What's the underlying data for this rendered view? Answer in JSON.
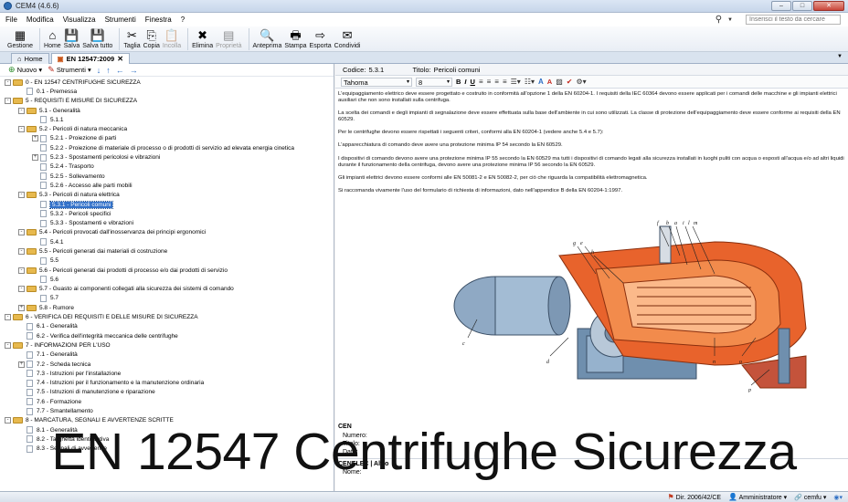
{
  "window": {
    "title": "CEM4 (4.6.6)"
  },
  "menu": [
    "File",
    "Modifica",
    "Visualizza",
    "Strumenti",
    "Finestra",
    "?"
  ],
  "search": {
    "placeholder": "Inserisci il testo da cercare"
  },
  "ribbon": [
    {
      "label": "Gestione",
      "icon": "grid-icon",
      "glyph": "▦",
      "disabled": false
    },
    {
      "label": "Home",
      "icon": "home-icon",
      "glyph": "⌂",
      "disabled": false
    },
    {
      "label": "Salva",
      "icon": "save-icon",
      "glyph": "💾",
      "disabled": false
    },
    {
      "label": "Salva tutto",
      "icon": "save-all-icon",
      "glyph": "💾",
      "disabled": false
    },
    {
      "label": "Taglia",
      "icon": "cut-icon",
      "glyph": "✂",
      "disabled": false
    },
    {
      "label": "Copia",
      "icon": "copy-icon",
      "glyph": "⎘",
      "disabled": false
    },
    {
      "label": "Incolla",
      "icon": "paste-icon",
      "glyph": "📋",
      "disabled": true
    },
    {
      "label": "Elimina",
      "icon": "delete-icon",
      "glyph": "✖",
      "disabled": false
    },
    {
      "label": "Proprietà",
      "icon": "properties-icon",
      "glyph": "▤",
      "disabled": true
    },
    {
      "label": "Anteprima",
      "icon": "preview-icon",
      "glyph": "🔍",
      "disabled": false
    },
    {
      "label": "Stampa",
      "icon": "print-icon",
      "glyph": "🖶",
      "disabled": false
    },
    {
      "label": "Esporta",
      "icon": "export-icon",
      "glyph": "⇨",
      "disabled": false
    },
    {
      "label": "Condividi",
      "icon": "share-icon",
      "glyph": "✉",
      "disabled": false
    }
  ],
  "tabs": [
    {
      "label": "Home",
      "active": false
    },
    {
      "label": "EN 12547:2009",
      "active": true
    }
  ],
  "tree_toolbar": {
    "new_label": "Nuovo",
    "tools_label": "Strumenti"
  },
  "tree": [
    {
      "level": 0,
      "type": "folder",
      "exp": "-",
      "label": "0 - EN 12547 CENTRIFUGHE SICUREZZA"
    },
    {
      "level": 1,
      "type": "doc",
      "exp": "",
      "label": "0.1 - Premessa"
    },
    {
      "level": 0,
      "type": "folder",
      "exp": "-",
      "label": "5 - REQUISITI E MISURE DI SICUREZZA"
    },
    {
      "level": 1,
      "type": "folder",
      "exp": "-",
      "label": "5.1 - Generalità"
    },
    {
      "level": 2,
      "type": "doc",
      "exp": "",
      "label": "5.1.1"
    },
    {
      "level": 1,
      "type": "folder",
      "exp": "-",
      "label": "5.2 - Pericoli di natura meccanica"
    },
    {
      "level": 2,
      "type": "doc",
      "exp": "+",
      "label": "5.2.1 - Proiezione di parti"
    },
    {
      "level": 2,
      "type": "doc",
      "exp": "",
      "label": "5.2.2 - Proiezione di materiale di processo o di prodotti di servizio ad elevata energia cinetica"
    },
    {
      "level": 2,
      "type": "doc",
      "exp": "+",
      "label": "5.2.3 - Spostamenti pericolosi e vibrazioni"
    },
    {
      "level": 2,
      "type": "doc",
      "exp": "",
      "label": "5.2.4 - Trasporto"
    },
    {
      "level": 2,
      "type": "doc",
      "exp": "",
      "label": "5.2.5 - Sollevamento"
    },
    {
      "level": 2,
      "type": "doc",
      "exp": "",
      "label": "5.2.6 - Accesso alle parti mobili"
    },
    {
      "level": 1,
      "type": "folder",
      "exp": "-",
      "label": "5.3 - Pericoli di natura elettrica"
    },
    {
      "level": 2,
      "type": "doc",
      "exp": "",
      "label": "5.3.1 - Pericoli comuni",
      "selected": true
    },
    {
      "level": 2,
      "type": "doc",
      "exp": "",
      "label": "5.3.2 - Pericoli specifici"
    },
    {
      "level": 2,
      "type": "doc",
      "exp": "",
      "label": "5.3.3 - Spostamenti e vibrazioni"
    },
    {
      "level": 1,
      "type": "folder",
      "exp": "-",
      "label": "5.4 - Pericoli provocati dall'inosservanza dei principi ergonomici"
    },
    {
      "level": 2,
      "type": "doc",
      "exp": "",
      "label": "5.4.1"
    },
    {
      "level": 1,
      "type": "folder",
      "exp": "-",
      "label": "5.5 - Pericoli generati dai materiali di costruzione"
    },
    {
      "level": 2,
      "type": "doc",
      "exp": "",
      "label": "5.5"
    },
    {
      "level": 1,
      "type": "folder",
      "exp": "-",
      "label": "5.6 - Pericoli generati dai prodotti di processo e/o dai prodotti di servizio"
    },
    {
      "level": 2,
      "type": "doc",
      "exp": "",
      "label": "5.6"
    },
    {
      "level": 1,
      "type": "folder",
      "exp": "-",
      "label": "5.7 - Guasto ai componenti collegati alla sicurezza dei sistemi di comando"
    },
    {
      "level": 2,
      "type": "doc",
      "exp": "",
      "label": "5.7"
    },
    {
      "level": 1,
      "type": "folder",
      "exp": "+",
      "label": "5.8 - Rumore"
    },
    {
      "level": 0,
      "type": "folder",
      "exp": "-",
      "label": "6 - VERIFICA DEI REQUISITI E DELLE MISURE DI SICUREZZA"
    },
    {
      "level": 1,
      "type": "doc",
      "exp": "",
      "label": "6.1 - Generalità"
    },
    {
      "level": 1,
      "type": "doc",
      "exp": "",
      "label": "6.2 - Verifica dell'integrità meccanica delle centrifughe"
    },
    {
      "level": 0,
      "type": "folder",
      "exp": "-",
      "label": "7 - INFORMAZIONI PER L'USO"
    },
    {
      "level": 1,
      "type": "doc",
      "exp": "",
      "label": "7.1 - Generalità"
    },
    {
      "level": 1,
      "type": "doc",
      "exp": "+",
      "label": "7.2 - Scheda tecnica"
    },
    {
      "level": 1,
      "type": "doc",
      "exp": "",
      "label": "7.3 - Istruzioni per l'installazione"
    },
    {
      "level": 1,
      "type": "doc",
      "exp": "",
      "label": "7.4 - Istruzioni per il funzionamento e la manutenzione ordinaria"
    },
    {
      "level": 1,
      "type": "doc",
      "exp": "",
      "label": "7.5 - Istruzioni di manutenzione e riparazione"
    },
    {
      "level": 1,
      "type": "doc",
      "exp": "",
      "label": "7.6 - Formazione"
    },
    {
      "level": 1,
      "type": "doc",
      "exp": "",
      "label": "7.7 - Smantellamento"
    },
    {
      "level": 0,
      "type": "folder",
      "exp": "-",
      "label": "8 - MARCATURA, SEGNALI E AVVERTENZE SCRITTE"
    },
    {
      "level": 1,
      "type": "doc",
      "exp": "",
      "label": "8.1 - Generalità"
    },
    {
      "level": 1,
      "type": "doc",
      "exp": "",
      "label": "8.2 - Targhetta identificativa"
    },
    {
      "level": 1,
      "type": "doc",
      "exp": "",
      "label": "8.3 - Segnali di avvertenze"
    }
  ],
  "editor": {
    "code_label": "Codice:",
    "code_value": "5.3.1",
    "title_label": "Titolo:",
    "title_value": "Pericoli comuni",
    "font": "Tahoma",
    "size": "8"
  },
  "paragraphs": [
    "L'equipaggiamento elettrico deve essere progettato e costruito in conformità all'opzione 1 della EN 60204-1. I requisiti della IEC 60364 devono essere applicati per i comandi delle macchine e gli impianti elettrici ausiliari che non sono installati sulla centrifuga.",
    "La scelta dei comandi e degli impianti di segnalazione deve essere effettuata sulla base dell'ambiente in cui sono utilizzati. La classe di protezione dell'equipaggiamento deve essere conforme ai requisiti della EN 60529.",
    "Per le centrifughe devono essere rispettati i seguenti criteri, conformi alla EN 60204-1 (vedere anche 5.4 e 5.7):",
    "L'apparecchiatura di comando deve avere una protezione minima IP 54 secondo la EN 60529.",
    "I dispositivi di comando devono avere una protezione minima IP 55 secondo la EN 60529 ma tutti i dispositivi di comando legati alla sicurezza installati in luoghi puliti con acqua o esposti all'acqua e/o ad altri liquidi durante il funzionamento della centrifuga, devono avere una protezione minima IP 56 secondo la EN 60529.",
    "Gli impianti elettrici devono essere conformi alle EN 50081-2 e EN 50082-2, per ciò che riguarda la compatibilità elettromagnetica.",
    "Si raccomanda vivamente l'uso del formulario di richiesta di informazioni, dato nell'appendice B della EN 60204-1:1997."
  ],
  "figure_labels": {
    "a": "a",
    "b": "b",
    "c": "c",
    "d": "d",
    "e": "e",
    "f": "f",
    "g": "g",
    "h": "h",
    "i": "i",
    "l": "l",
    "m": "m",
    "n": "n",
    "o": "o",
    "p": "p"
  },
  "refs": {
    "cen_title": "CEN",
    "cen_number_label": "Numero:",
    "cen_title_label": "Titolo:",
    "cen_date_label": "Data:",
    "cenelec_title": "CENELEC | Altro",
    "cenelec_name_label": "Nome:"
  },
  "status": {
    "directive": "Dir. 2006/42/CE",
    "role": "Amministratore",
    "user": "cemfu"
  },
  "overlay_text": "EN 12547 Centrifughe Sicurezza",
  "colors": {
    "selection": "#3271c9",
    "folder": "#e7b94e",
    "accent": "#2f6fc4"
  }
}
